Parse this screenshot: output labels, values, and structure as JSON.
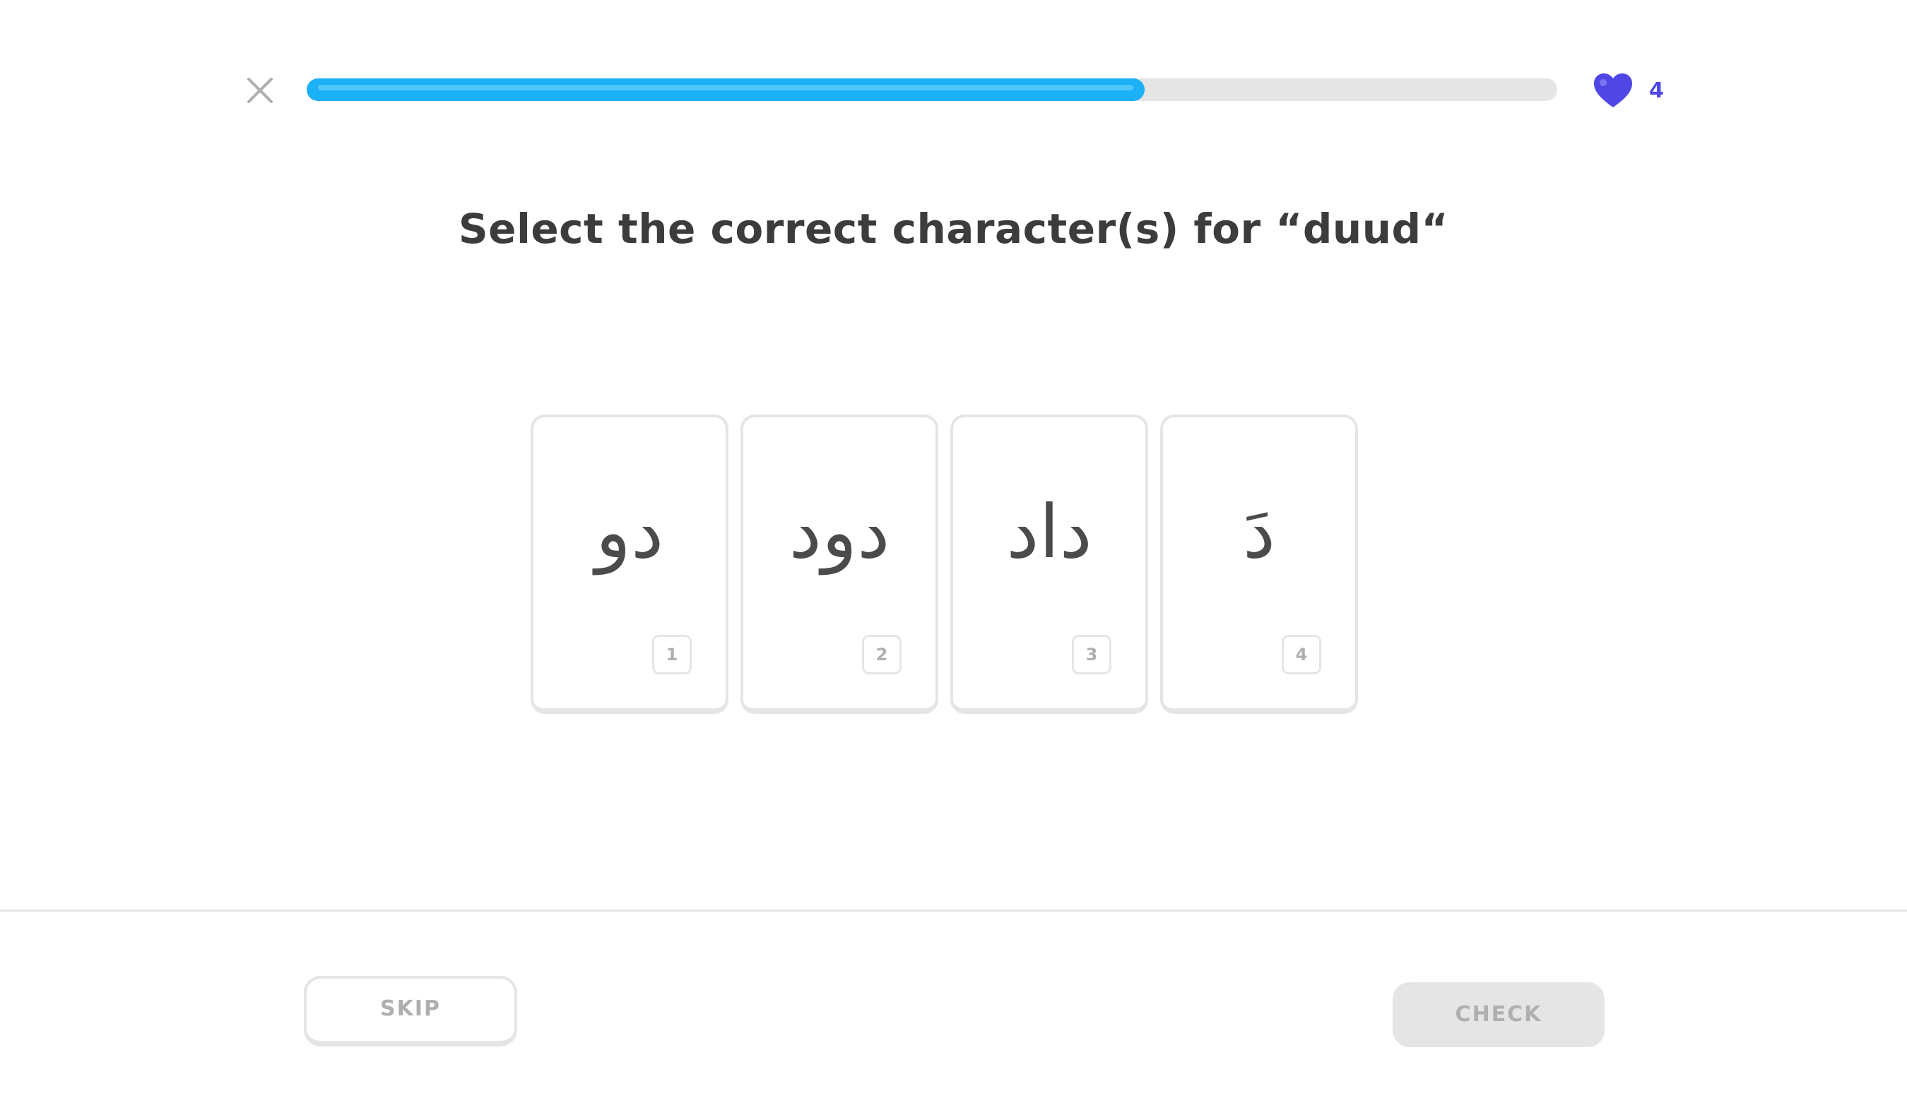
{
  "header": {
    "close_icon": "close-icon",
    "progress": {
      "value": 0.67
    },
    "hearts": {
      "icon": "heart-icon",
      "count": "4",
      "color": "#4f46e5"
    },
    "progress_color": "#1cb0f6"
  },
  "prompt": {
    "text": "Select the correct character(s) for “duud“"
  },
  "choices": [
    {
      "text": "دو",
      "key": "1"
    },
    {
      "text": "دود",
      "key": "2"
    },
    {
      "text": "داد",
      "key": "3"
    },
    {
      "text": "دَ",
      "key": "4"
    }
  ],
  "footer": {
    "skip_label": "SKIP",
    "check_label": "CHECK"
  }
}
